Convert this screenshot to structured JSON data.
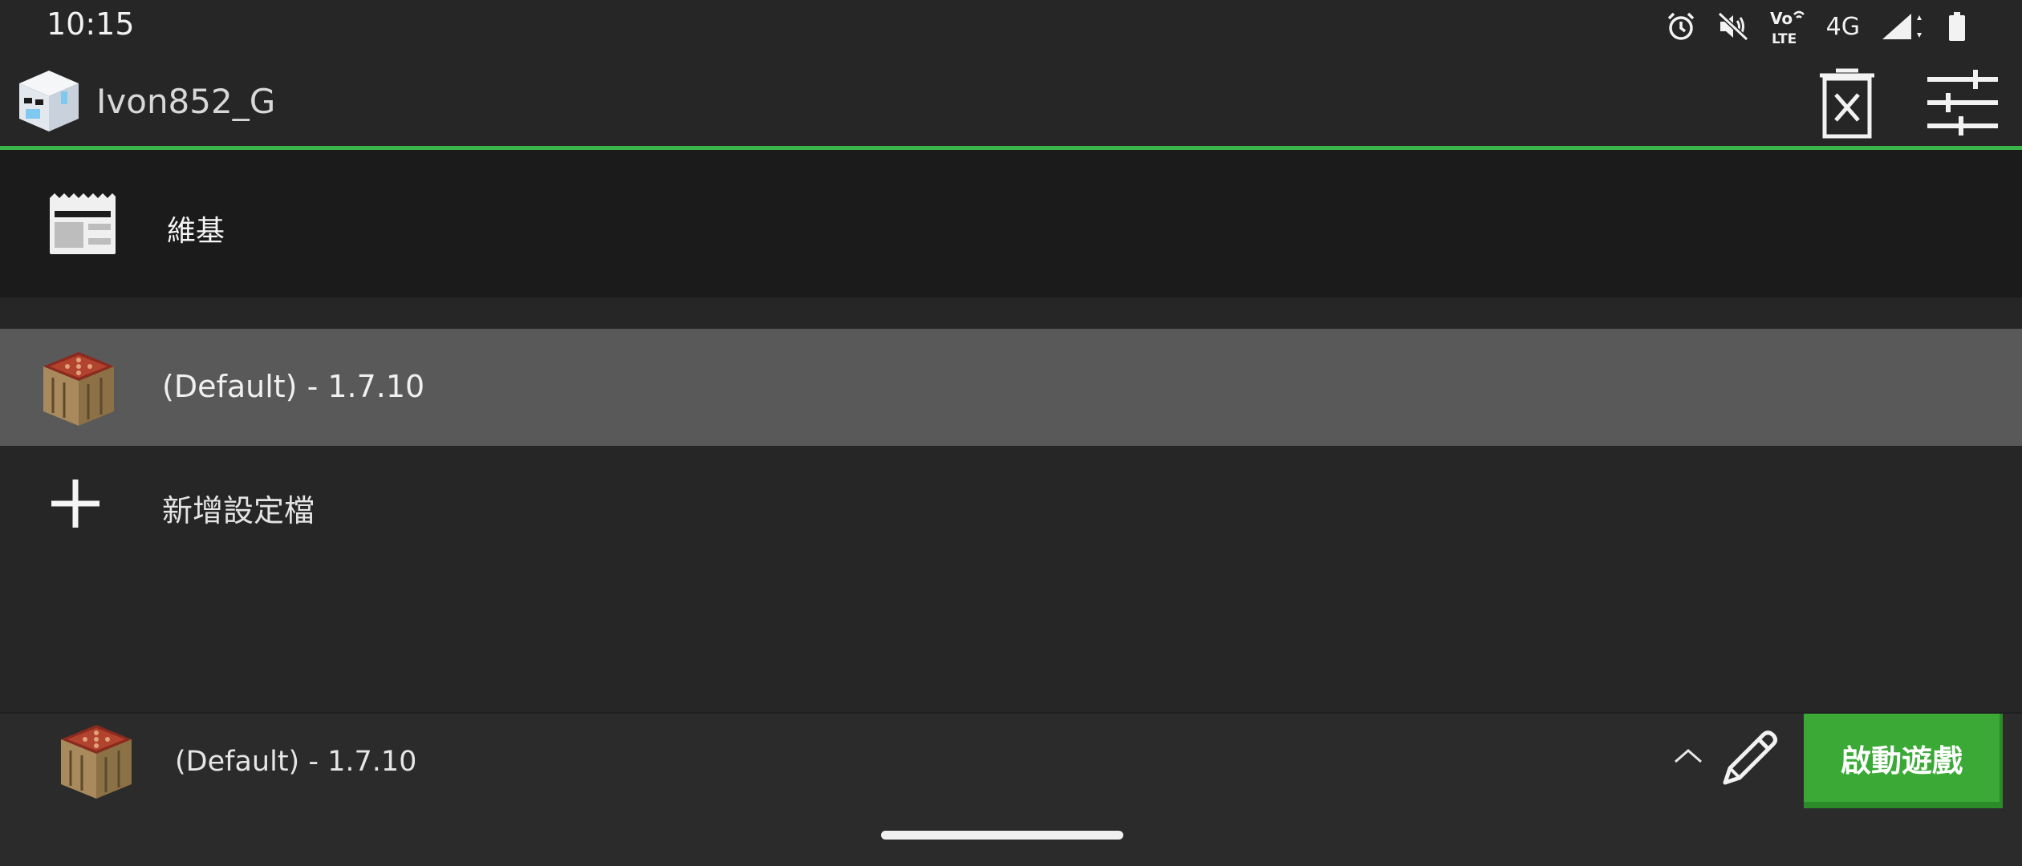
{
  "status_bar": {
    "time": "10:15",
    "network": "4G",
    "icons": [
      "alarm-icon",
      "mute-icon",
      "volte-icon",
      "signal-icon",
      "battery-icon"
    ]
  },
  "header": {
    "username": "Ivon852_G",
    "actions": [
      "delete-account-icon",
      "settings-sliders-icon"
    ]
  },
  "wiki": {
    "label": "維基"
  },
  "profiles": {
    "items": [
      {
        "label": "(Default) - 1.7.10",
        "selected": true
      }
    ],
    "add_label": "新增設定檔"
  },
  "bottom_bar": {
    "selected_profile": "(Default) - 1.7.10",
    "launch_label": "啟動遊戲"
  },
  "colors": {
    "accent": "#39b54a",
    "launch_button": "#3aa935",
    "background": "#262626",
    "selected_row": "#595959"
  }
}
